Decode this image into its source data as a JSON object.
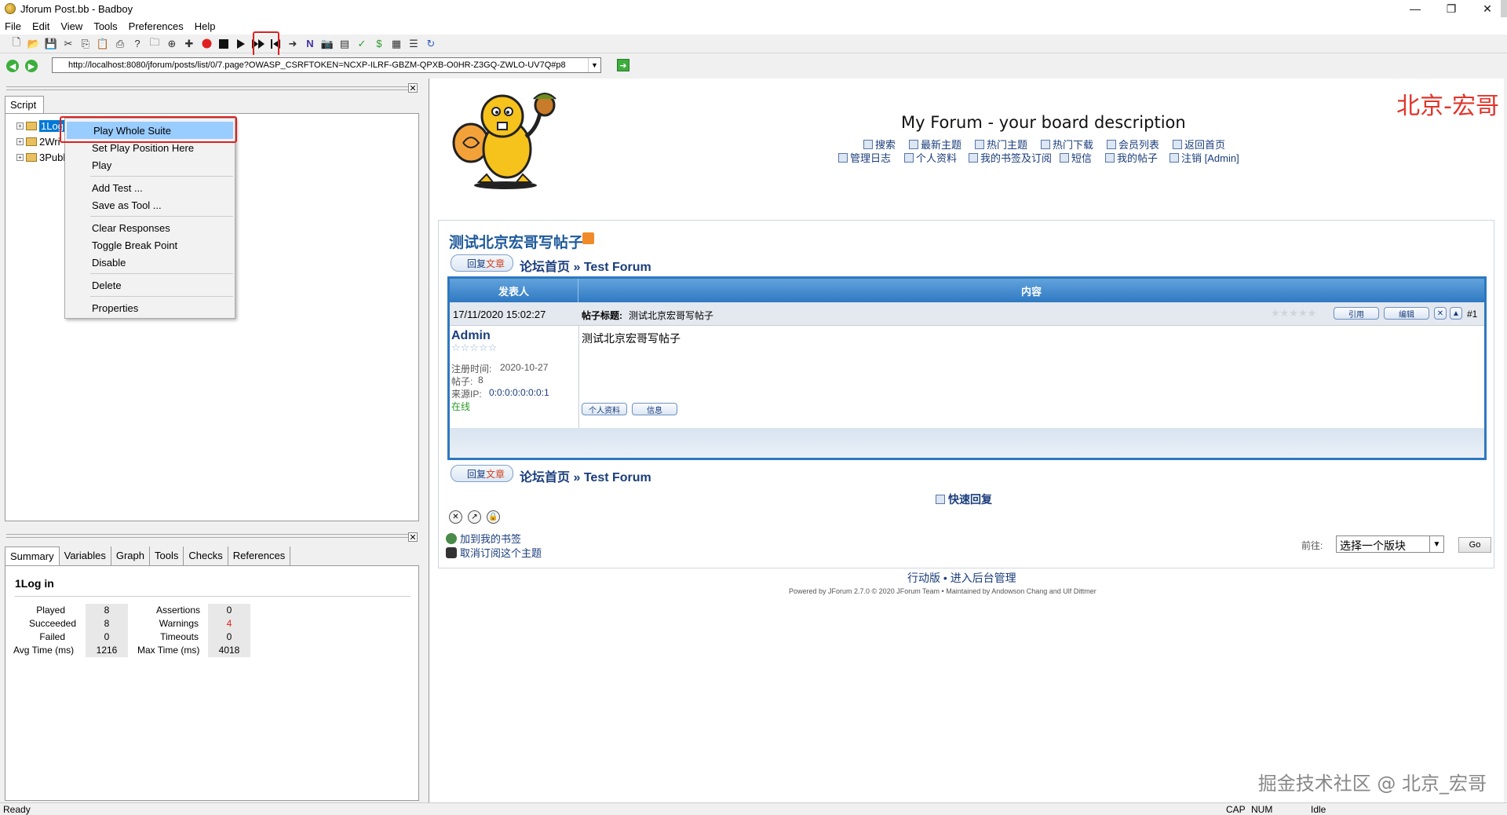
{
  "window": {
    "title": "Jforum Post.bb - Badboy",
    "minimize": "—",
    "maximize": "❐",
    "close": "✕"
  },
  "menu": [
    "File",
    "Edit",
    "View",
    "Tools",
    "Preferences",
    "Help"
  ],
  "address": {
    "url": "http://localhost:8080/jforum/posts/list/0/7.page?OWASP_CSRFTOKEN=NCXP-ILRF-GBZM-QPXB-O0HR-Z3GQ-ZWLO-UV7Q#p8"
  },
  "script_pane": {
    "tab": "Script",
    "tree": [
      "1Log",
      "2Wri",
      "3Publ"
    ]
  },
  "context_menu": {
    "items": [
      "Play Whole Suite",
      "Set Play Position Here",
      "Play",
      "Add Test ...",
      "Save as Tool ...",
      "Clear Responses",
      "Toggle Break Point",
      "Disable",
      "Delete",
      "Properties"
    ]
  },
  "bottom_tabs": [
    "Summary",
    "Variables",
    "Graph",
    "Tools",
    "Checks",
    "References"
  ],
  "summary": {
    "title": "1Log in",
    "left_labels": [
      "Played",
      "Succeeded",
      "Failed",
      "Avg Time (ms)"
    ],
    "left_values": [
      "8",
      "8",
      "0",
      "1216"
    ],
    "right_labels": [
      "Assertions",
      "Warnings",
      "Timeouts",
      "Max Time (ms)"
    ],
    "right_values": [
      "0",
      "4",
      "0",
      "4018"
    ],
    "warning_color": "#e02020"
  },
  "browser": {
    "brand": "北京-宏哥",
    "forum_title": "My Forum - your board description",
    "nav_row1": [
      "搜索",
      "最新主题",
      "热门主题",
      "热门下载",
      "会员列表",
      "返回首页"
    ],
    "nav_row2": [
      "管理日志",
      "个人资料",
      "我的书签及订阅",
      "短信",
      "我的帖子",
      "注销 [Admin]"
    ],
    "thread_title": "测试北京宏哥写帖子",
    "reply_label_a": "回复",
    "reply_label_b": "文章",
    "crumb_home": "论坛首页",
    "crumb_sep": "»",
    "crumb_forum": "Test Forum",
    "col_author": "发表人",
    "col_content": "内容",
    "post_date": "17/11/2020 15:02:27",
    "subject_label": "帖子标题:",
    "subject_value": "测试北京宏哥写帖子",
    "quote_btn": "引用",
    "edit_btn": "编辑",
    "post_num": "#1",
    "author": "Admin",
    "register_label": "注册时间:",
    "register_date": "2020-10-27",
    "posts_label": "帖子:",
    "posts_count": "8",
    "ip_label": "来源IP:",
    "ip_value": "0:0:0:0:0:0:0:1",
    "online": "在线",
    "post_body": "测试北京宏哥写帖子",
    "profile_btn": "个人资料",
    "msg_btn": "信息",
    "quick_reply": "快速回复",
    "bookmark": "加到我的书签",
    "unsubscribe": "取消订阅这个主题",
    "jump_label": "前往:",
    "jump_select": "选择一个版块",
    "jump_go": "Go",
    "footer_links": [
      "行动版",
      "进入后台管理"
    ],
    "footer_sep": "•",
    "powered_by": "Powered by JForum 2.7.0 © 2020 JForum Team • Maintained by Andowson Chang and Ulf Dittmer"
  },
  "status": {
    "left": "Ready",
    "cap": "CAP",
    "num": "NUM",
    "idle": "Idle"
  },
  "watermark": "掘金技术社区 @ 北京_宏哥",
  "colors": {
    "accent_blue": "#2d78c0",
    "highlight_red": "#e02020",
    "brand_red": "#e0352b"
  }
}
